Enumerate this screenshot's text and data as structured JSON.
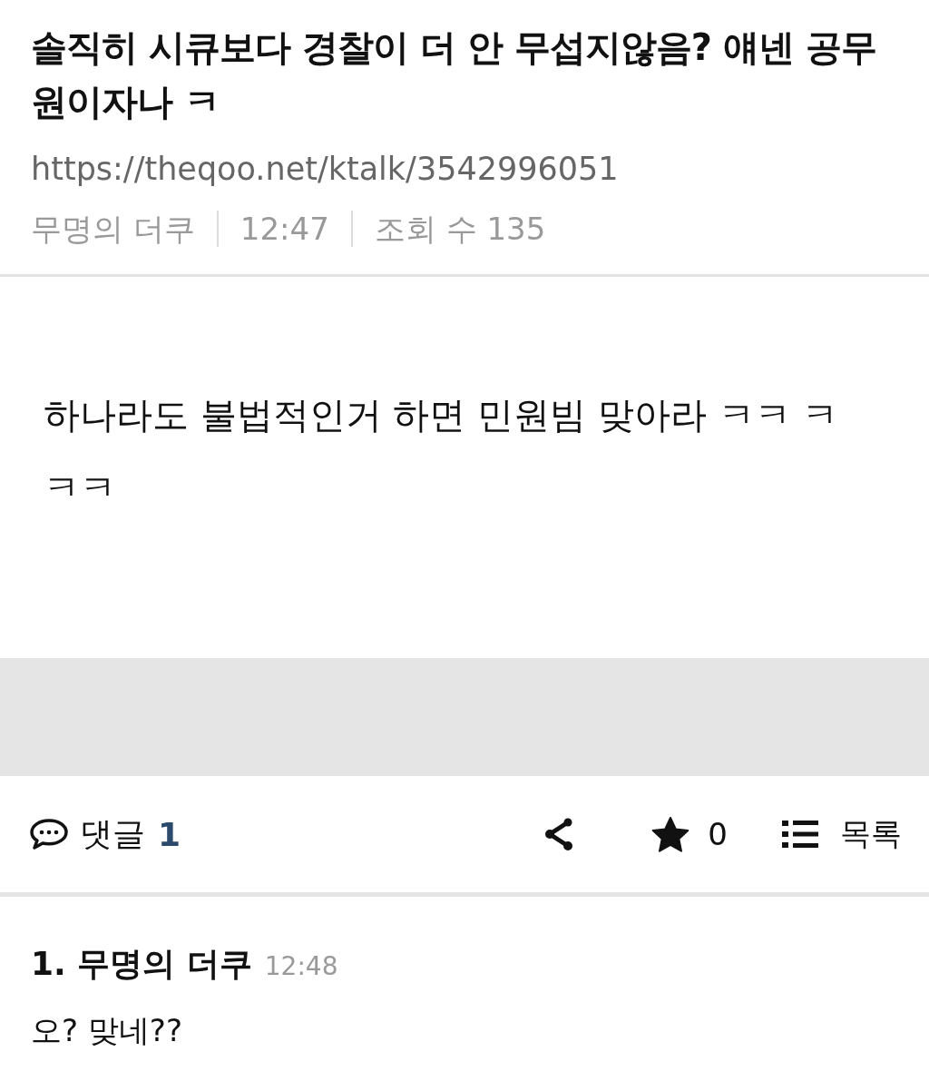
{
  "post": {
    "title": "솔직히 시큐보다 경찰이 더 안 무섭지않음? 얘넨 공무원이자나 ㅋ",
    "url": "https://theqoo.net/ktalk/3542996051",
    "author": "무명의 더쿠",
    "time": "12:47",
    "views": "조회 수 135",
    "body": "하나라도 불법적인거 하면 민원빔 맞아라 ㅋㅋ ㅋㅋㅋ"
  },
  "toolbar": {
    "comment_label": "댓글",
    "comment_count": "1",
    "star_count": "0",
    "list_label": "목록"
  },
  "comments": [
    {
      "number": "1.",
      "author": "무명의 더쿠",
      "time": "12:48",
      "text": "오? 맞네??"
    }
  ]
}
